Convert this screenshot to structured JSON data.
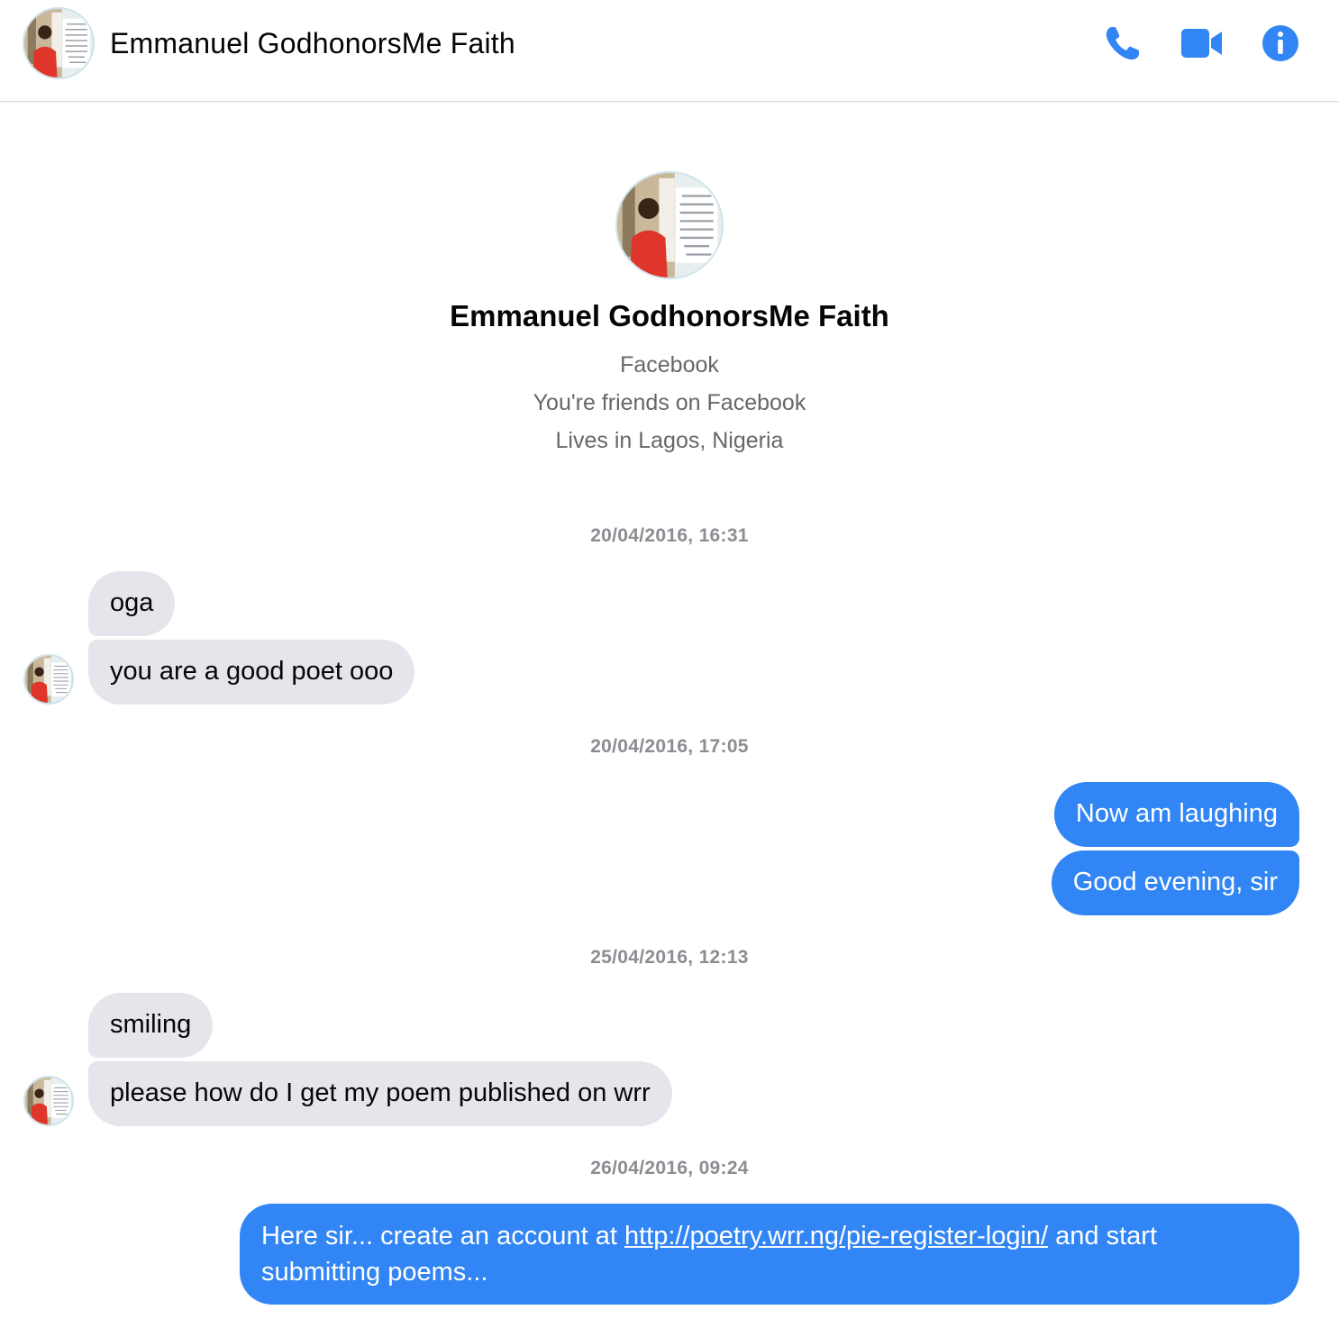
{
  "header": {
    "title": "Emmanuel GodhonorsMe Faith",
    "icons": [
      "phone-icon",
      "video-camera-icon",
      "info-icon"
    ],
    "accent_color": "#3185f4"
  },
  "profile": {
    "name": "Emmanuel GodhonorsMe Faith",
    "platform": "Facebook",
    "friendship": "You're friends on Facebook",
    "location": "Lives in Lagos, Nigeria"
  },
  "conversation": {
    "timestamps": [
      "20/04/2016, 16:31",
      "20/04/2016, 17:05",
      "25/04/2016, 12:13",
      "26/04/2016, 09:24"
    ],
    "messages": [
      {
        "direction": "incoming",
        "text": "oga"
      },
      {
        "direction": "incoming",
        "text": "you are a good poet ooo"
      },
      {
        "direction": "outgoing",
        "text": "Now am laughing"
      },
      {
        "direction": "outgoing",
        "text": "Good evening, sir"
      },
      {
        "direction": "incoming",
        "text": "smiling"
      },
      {
        "direction": "incoming",
        "text": "please how do I get my poem published on wrr"
      },
      {
        "direction": "outgoing",
        "text_before": "Here sir... create an account at ",
        "link": "http://poetry.wrr.ng/pie-register-login/",
        "text_after": " and start",
        "text_line2": "submitting poems..."
      }
    ],
    "colors": {
      "incoming_bubble": "#e4e6eb",
      "outgoing_bubble": "#3185f4",
      "timestamp": "#8a8d91"
    }
  }
}
